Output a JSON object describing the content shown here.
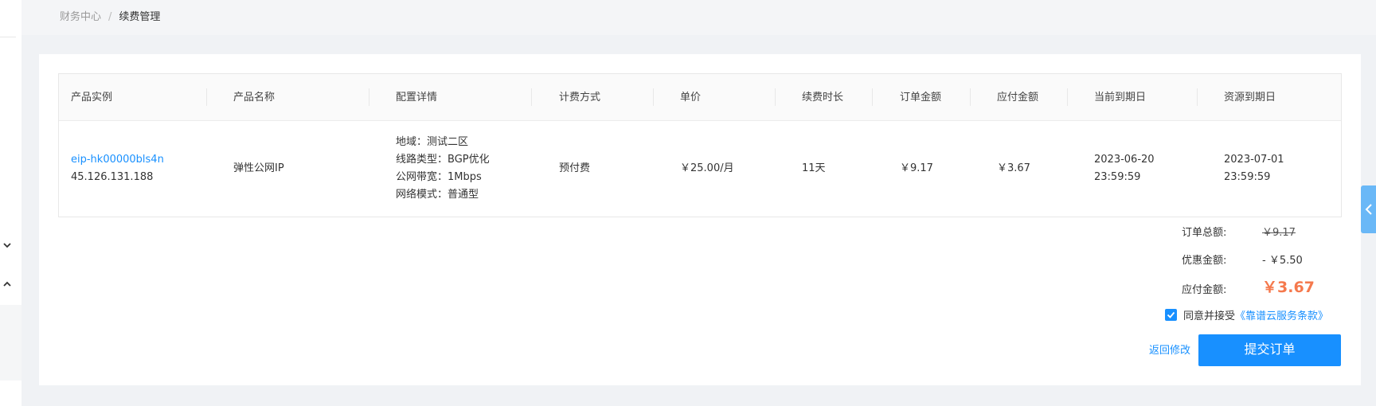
{
  "breadcrumb": {
    "parent": "财务中心",
    "separator": "/",
    "current": "续费管理"
  },
  "table": {
    "headers": [
      "产品实例",
      "产品名称",
      "配置详情",
      "计费方式",
      "单价",
      "续费时长",
      "订单金额",
      "应付金额",
      "当前到期日",
      "资源到期日"
    ],
    "row": {
      "instance_id": "eip-hk00000bls4n",
      "instance_ip": "45.126.131.188",
      "product_name": "弹性公网IP",
      "config": [
        "地域：测试二区",
        "线路类型：BGP优化",
        "公网带宽：1Mbps",
        "网络模式：普通型"
      ],
      "billing": "预付费",
      "unit_price": "￥25.00/月",
      "duration": "11天",
      "order_amount": "￥9.17",
      "payable": "￥3.67",
      "current_expiry_date": "2023-06-20",
      "current_expiry_time": "23:59:59",
      "resource_expiry_date": "2023-07-01",
      "resource_expiry_time": "23:59:59"
    }
  },
  "summary": {
    "order_total_label": "订单总额:",
    "order_total_value": "￥9.17",
    "discount_label": "优惠金额:",
    "discount_value": "- ￥5.50",
    "payable_label": "应付金额:",
    "payable_value": "￥3.67"
  },
  "agreement": {
    "checked": true,
    "text": "同意并接受",
    "terms": "《靠谱云服务条款》"
  },
  "actions": {
    "back_label": "返回修改",
    "submit_label": "提交订单"
  },
  "colors": {
    "accent": "#1890ff",
    "price": "#f5794d"
  }
}
